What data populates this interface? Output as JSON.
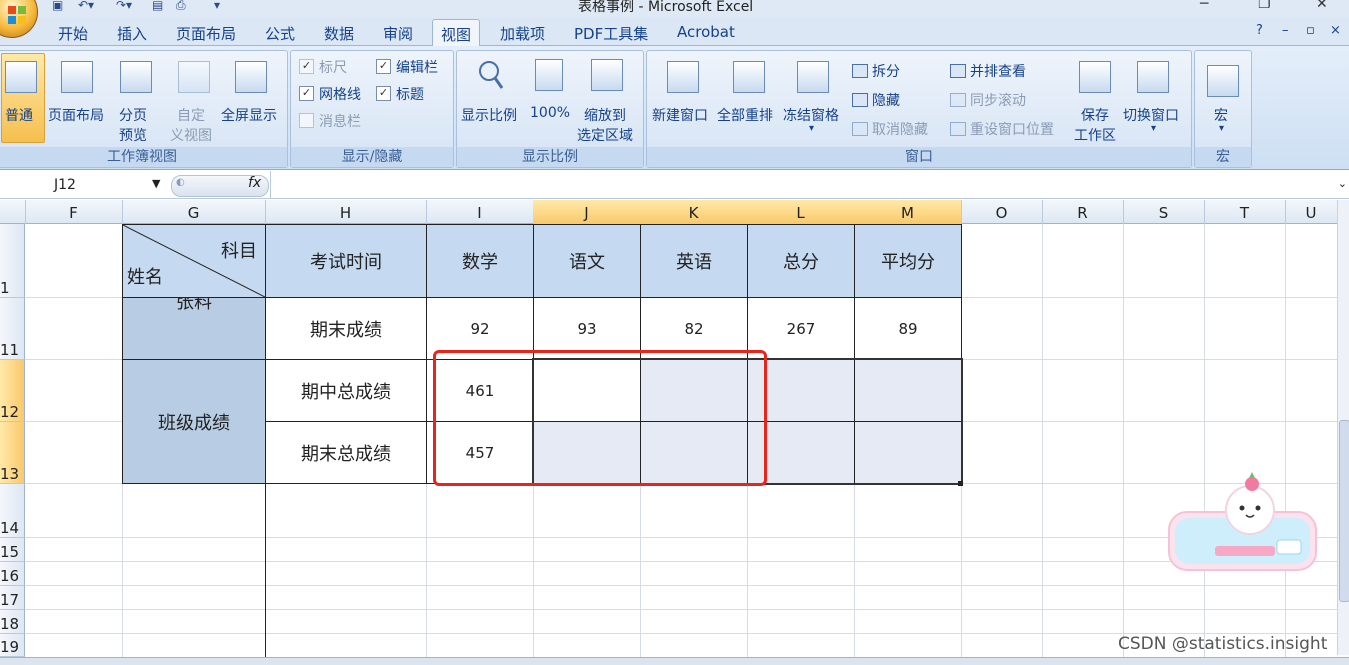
{
  "window": {
    "title": "表格事例 - Microsoft Excel"
  },
  "menu_tabs": [
    "开始",
    "插入",
    "页面布局",
    "公式",
    "数据",
    "审阅",
    "视图",
    "加载项",
    "PDF工具集",
    "Acrobat"
  ],
  "active_tab": "视图",
  "ribbon": {
    "workbook_views": {
      "label": "工作簿视图",
      "normal": "普通",
      "page_layout": "页面布局",
      "page_break_1": "分页",
      "page_break_2": "预览",
      "custom_1": "自定",
      "custom_2": "义视图",
      "fullscreen": "全屏显示"
    },
    "show_hide": {
      "label": "显示/隐藏",
      "ruler": "标尺",
      "formula_bar": "编辑栏",
      "gridlines": "网格线",
      "headings": "标题",
      "message_bar": "消息栏"
    },
    "zoom": {
      "label": "显示比例",
      "zoom": "显示比例",
      "zoom100": "100%",
      "zoom_sel_1": "缩放到",
      "zoom_sel_2": "选定区域"
    },
    "window": {
      "label": "窗口",
      "new_window": "新建窗口",
      "arrange_all": "全部重排",
      "freeze": "冻结窗格",
      "split": "拆分",
      "hide": "隐藏",
      "unhide": "取消隐藏",
      "side_by_side": "并排查看",
      "sync_scroll": "同步滚动",
      "reset_pos": "重设窗口位置",
      "save_ws_1": "保存",
      "save_ws_2": "工作区",
      "switch": "切换窗口"
    },
    "macros": {
      "label": "宏",
      "macros": "宏"
    }
  },
  "formula_bar": {
    "name_box": "J12",
    "fx": "fx",
    "value": ""
  },
  "columns": [
    "F",
    "G",
    "H",
    "I",
    "J",
    "K",
    "L",
    "M",
    "O",
    "R",
    "S",
    "T",
    "U"
  ],
  "rows": [
    "1",
    "11",
    "12",
    "13",
    "14",
    "15",
    "16",
    "17",
    "18",
    "19"
  ],
  "table": {
    "diag_top": "科目",
    "diag_bottom": "姓名",
    "cut_name": "张料",
    "headers": [
      "考试时间",
      "数学",
      "语文",
      "英语",
      "总分",
      "平均分"
    ],
    "row11": [
      "期末成绩",
      "92",
      "93",
      "82",
      "267",
      "89"
    ],
    "group_label": "班级成绩",
    "row12": [
      "期中总成绩",
      "461"
    ],
    "row13": [
      "期末总成绩",
      "457"
    ]
  },
  "watermark": "CSDN @statistics.insight",
  "colors": {
    "header_fill": "#c5d9f1",
    "group_fill": "#b8cce4",
    "selection_fill": "#e6eaf4",
    "highlight": "#e8251b"
  }
}
